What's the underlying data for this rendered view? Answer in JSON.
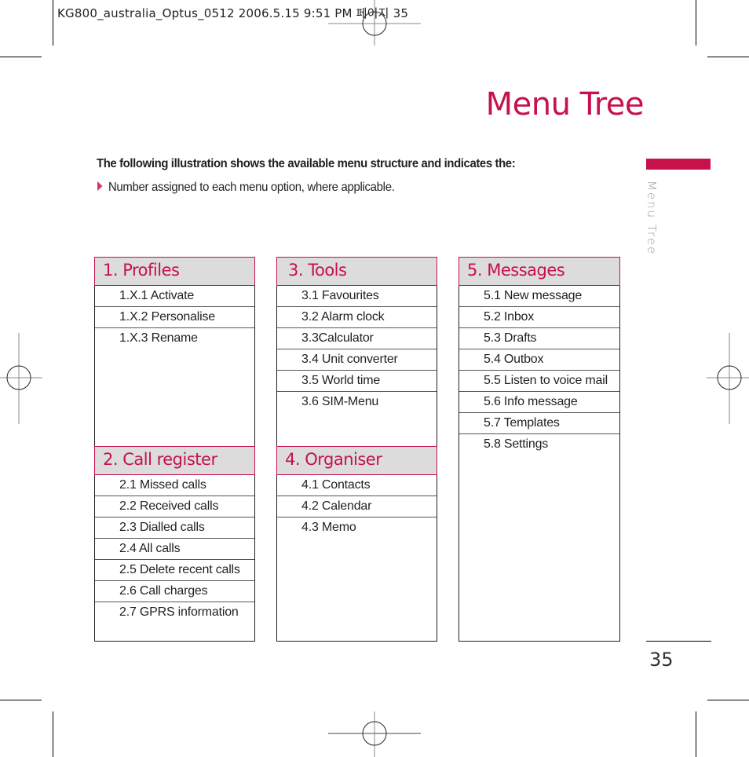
{
  "print_header": "KG800_australia_Optus_0512  2006.5.15 9:51 PM 페이지 35",
  "page_title": "Menu Tree",
  "side_tab_label": "Menu Tree",
  "intro": {
    "heading": "The following illustration shows the available menu structure and indicates the:",
    "bullets": [
      "Number assigned to each menu option, where applicable."
    ],
    "bullet_icon": "triangle-right-icon"
  },
  "colors": {
    "accent": "#c8104a",
    "header_fill": "#dcdcdc",
    "text": "#231f20",
    "side_label": "#9a9a9a"
  },
  "menus": [
    {
      "title": "1. Profiles",
      "items": [
        "1.X.1 Activate",
        "1.X.2 Personalise",
        "1.X.3 Rename"
      ]
    },
    {
      "title": "2. Call register",
      "items": [
        "2.1 Missed calls",
        "2.2 Received calls",
        "2.3 Dialled calls",
        "2.4 All calls",
        "2.5 Delete recent calls",
        "2.6 Call charges",
        "2.7 GPRS information"
      ]
    },
    {
      "title": "3. Tools",
      "items": [
        "3.1 Favourites",
        "3.2 Alarm clock",
        "3.3Calculator",
        "3.4 Unit converter",
        "3.5 World time",
        "3.6 SIM-Menu"
      ]
    },
    {
      "title": "4. Organiser",
      "items": [
        "4.1 Contacts",
        "4.2 Calendar",
        "4.3 Memo"
      ]
    },
    {
      "title": "5. Messages",
      "items": [
        "5.1 New message",
        "5.2 Inbox",
        "5.3 Drafts",
        "5.4 Outbox",
        "5.5 Listen to voice mail",
        "5.6 Info message",
        "5.7 Templates",
        "5.8 Settings"
      ]
    }
  ],
  "page_number": "35"
}
